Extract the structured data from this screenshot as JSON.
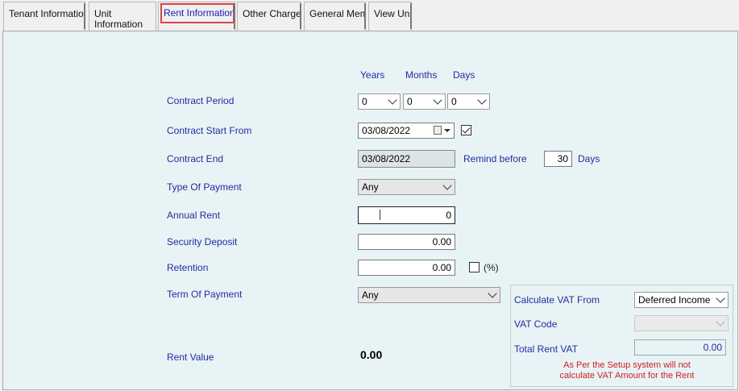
{
  "tabs": [
    {
      "label": "Tenant Information"
    },
    {
      "label": "Unit Information"
    },
    {
      "label": "Rent Information"
    },
    {
      "label": "Other Charges"
    },
    {
      "label": "General Memo"
    },
    {
      "label": "View Unit"
    }
  ],
  "period_headers": {
    "years": "Years",
    "months": "Months",
    "days": "Days"
  },
  "contract_period": {
    "label": "Contract Period",
    "years": "0",
    "months": "0",
    "days": "0"
  },
  "contract_start": {
    "label": "Contract Start From",
    "value": "03/08/2022",
    "checked": true
  },
  "contract_end": {
    "label": "Contract End",
    "value": "03/08/2022"
  },
  "remind": {
    "label": "Remind before",
    "value": "30",
    "unit": "Days"
  },
  "type_of_payment": {
    "label": "Type Of Payment",
    "value": "Any"
  },
  "annual_rent": {
    "label": "Annual Rent",
    "value": "0"
  },
  "security_deposit": {
    "label": "Security Deposit",
    "value": "0.00"
  },
  "retention": {
    "label": "Retention",
    "value": "0.00",
    "pct_label": "(%)"
  },
  "term_of_payment": {
    "label": "Term Of Payment",
    "value": "Any"
  },
  "rent_value": {
    "label": "Rent Value",
    "value": "0.00"
  },
  "vat": {
    "calculate_from_label": "Calculate VAT From",
    "calculate_from_value": "Deferred Income",
    "code_label": "VAT Code",
    "code_value": "",
    "total_label": "Total Rent VAT",
    "total_value": "0.00",
    "warning": "As Per the Setup system will not calculate VAT Amount for the Rent"
  },
  "colors": {
    "label_blue": "#1e2f9e",
    "panel_bg": "#e8f3f5",
    "warning_red": "#cc2222",
    "active_outline": "#d94545"
  }
}
